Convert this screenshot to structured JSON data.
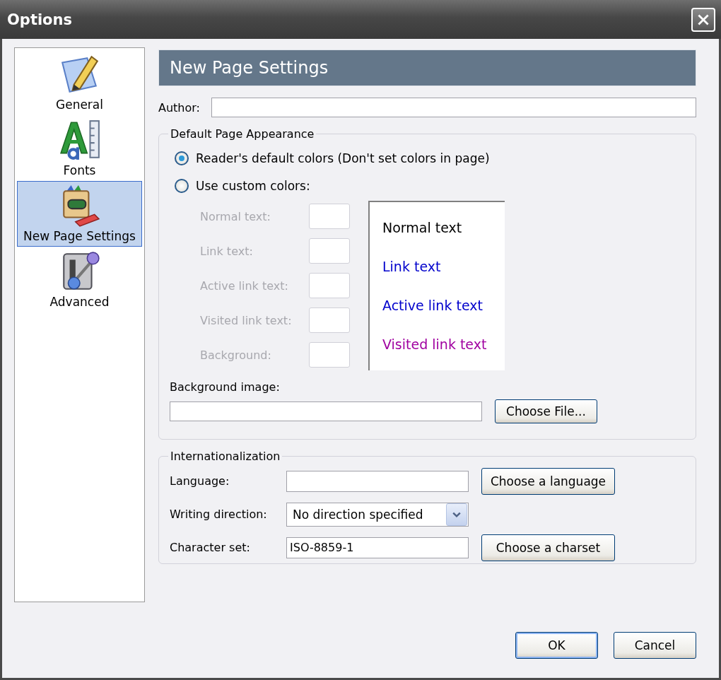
{
  "window": {
    "title": "Options"
  },
  "sidebar": {
    "items": [
      {
        "label": "General",
        "kind": "general",
        "selected": false
      },
      {
        "label": "Fonts",
        "kind": "fonts",
        "selected": false
      },
      {
        "label": "New Page Settings",
        "kind": "new-page",
        "selected": true
      },
      {
        "label": "Advanced",
        "kind": "advanced",
        "selected": false
      }
    ]
  },
  "header": {
    "title": "New Page Settings"
  },
  "author": {
    "label": "Author:"
  },
  "appearance": {
    "legend": "Default Page Appearance",
    "options": [
      {
        "label": "Reader's default colors (Don't set colors in page)",
        "selected": true
      },
      {
        "label": "Use custom colors:",
        "selected": false
      }
    ],
    "color_fields": {
      "disabled": true,
      "items": [
        {
          "label": "Normal text:"
        },
        {
          "label": "Link text:"
        },
        {
          "label": "Active link text:"
        },
        {
          "label": "Visited link text:"
        },
        {
          "label": "Background:"
        }
      ]
    },
    "preview": [
      {
        "text": "Normal text",
        "color": "#000000"
      },
      {
        "text": "Link text",
        "color": "#0000cc"
      },
      {
        "text": "Active link text",
        "color": "#0000cc"
      },
      {
        "text": "Visited link text",
        "color": "#a000a0"
      }
    ],
    "background_image": {
      "label": "Background image:",
      "button": "Choose File..."
    }
  },
  "internationalization": {
    "legend": "Internationalization",
    "rows": [
      {
        "kind": "text",
        "label": "Language:",
        "button": "Choose a language"
      },
      {
        "kind": "select",
        "label": "Writing direction:",
        "value": "No direction specified"
      },
      {
        "kind": "text",
        "label": "Character set:",
        "value": "ISO-8859-1",
        "button": "Choose a charset"
      }
    ]
  },
  "buttons": [
    {
      "label": "OK",
      "default": true
    },
    {
      "label": "Cancel",
      "default": false
    }
  ]
}
